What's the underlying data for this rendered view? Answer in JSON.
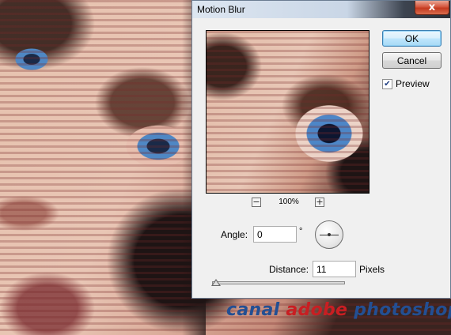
{
  "dialog": {
    "title": "Motion Blur",
    "close_glyph": "x",
    "ok_label": "OK",
    "cancel_label": "Cancel",
    "preview_label": "Preview",
    "preview_checked": true,
    "zoom": {
      "minus_glyph": "−",
      "plus_glyph": "+",
      "value": "100%"
    },
    "angle": {
      "label": "Angle:",
      "value": "0",
      "unit": "°"
    },
    "distance": {
      "label": "Distance:",
      "value": "11",
      "unit": "Pixels",
      "slider_level": 0.03
    }
  },
  "watermark": {
    "part1": "canal ",
    "part2": "adobe",
    "part3": " photoshop"
  },
  "colors": {
    "ok_button_border": "#3c7fb1",
    "close_button": "#c43a20",
    "watermark_blue": "#234f93",
    "watermark_red": "#c91e22"
  },
  "icons": {
    "close": "close-icon",
    "zoom_out": "zoom-out-icon",
    "zoom_in": "zoom-in-icon",
    "check": "checkmark-icon",
    "angle_dial": "angle-dial-icon"
  }
}
